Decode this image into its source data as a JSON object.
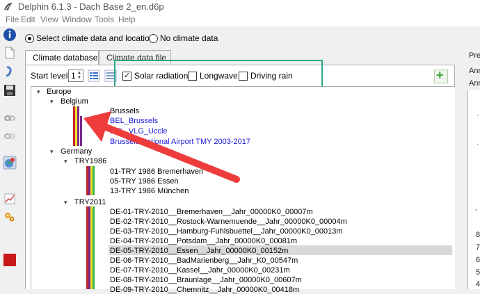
{
  "window": {
    "title": "Delphin 6.1.3 - Dach Base 2_en.d6p"
  },
  "menu": [
    "File",
    "Edit",
    "View",
    "Window",
    "Tools",
    "Help"
  ],
  "climate_mode": {
    "option_selected": "Select climate data and location",
    "option_other": "No climate data"
  },
  "tabs": [
    "Climate database",
    "Climate data file"
  ],
  "toolbar": {
    "start_level_label": "Start level",
    "start_level_value": "1"
  },
  "filters": [
    {
      "label": "Solar radiation",
      "checked": true
    },
    {
      "label": "Longwave",
      "checked": false
    },
    {
      "label": "Driving rain",
      "checked": false
    }
  ],
  "tree": {
    "europe": "Europe",
    "belgium": "Belgium",
    "belgium_items": [
      "Brussels",
      "BEL_Brussels",
      "BEL_VLG_Uccle",
      "Brussels National Airport TMY 2003-2017"
    ],
    "germany": "Germany",
    "try1986": "TRY1986",
    "try1986_items": [
      "01-TRY 1986 Bremerhaven",
      "05-TRY 1986 Essen",
      "13-TRY 1986 München"
    ],
    "try2011": "TRY2011",
    "try2011_items": [
      "DE-01-TRY-2010__Bremerhaven__Jahr_00000K0_00007m",
      "DE-02-TRY-2010__Rostock-Warnemuende__Jahr_00000K0_00004m",
      "DE-03-TRY-2010__Hamburg-Fuhlsbuettel__Jahr_00000K0_00013m",
      "DE-04-TRY-2010__Potsdam__Jahr_00000K0_00081m",
      "DE-05-TRY-2010__Essen__Jahr_00000K0_00152m",
      "DE-06-TRY-2010__BadMarienberg__Jahr_K0_00547m",
      "DE-07-TRY-2010__Kassel__Jahr_00000K0_00231m",
      "DE-08-TRY-2010__Braunlage__Jahr_00000K0_00607m",
      "DE-09-TRY-2010__Chemnitz__Jahr_00000K0_00418m"
    ]
  },
  "right_panel": {
    "header": "Prev",
    "lines": [
      "Ann",
      "Ann"
    ],
    "axis_labels": [
      "8",
      "7",
      "6",
      "5",
      "4"
    ]
  },
  "colors": {
    "highlight": "#2aa88a",
    "arrow": "#ee3b3b",
    "link": "#1a1adb",
    "bar_red": "#c3262b",
    "bar_yellow": "#f2df2c",
    "bar_purple": "#7a2a8a",
    "bar_green": "#39b34a"
  }
}
